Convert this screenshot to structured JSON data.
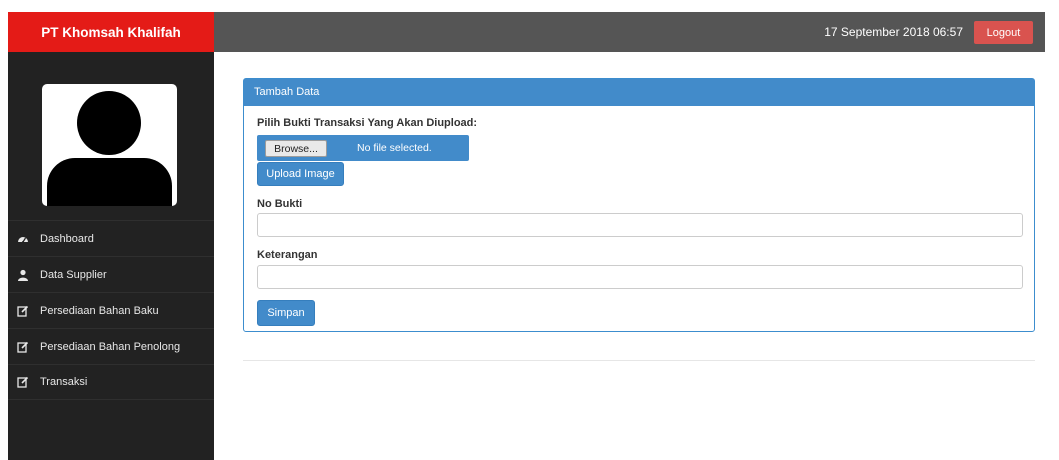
{
  "sidebar": {
    "brand": "PT Khomsah Khalifah",
    "items": [
      {
        "label": "Dashboard",
        "icon": "dashboard-icon"
      },
      {
        "label": "Data Supplier",
        "icon": "user-icon"
      },
      {
        "label": "Persediaan Bahan Baku",
        "icon": "edit-icon"
      },
      {
        "label": "Persediaan Bahan Penolong",
        "icon": "edit-icon"
      },
      {
        "label": "Transaksi",
        "icon": "edit-icon"
      }
    ]
  },
  "header": {
    "datetime": "17 September 2018 06:57",
    "logout_label": "Logout"
  },
  "panel": {
    "title": "Tambah Data",
    "upload_label": "Pilih Bukti Transaksi Yang Akan Diupload:",
    "browse_label": "Browse...",
    "file_status": "No file selected.",
    "upload_button": "Upload Image",
    "no_bukti_label": "No Bukti",
    "no_bukti_value": "",
    "keterangan_label": "Keterangan",
    "keterangan_value": "",
    "save_button": "Simpan"
  },
  "colors": {
    "brand_red": "#e41b17",
    "sidebar_bg": "#222222",
    "topbar_bg": "#555555",
    "primary_blue": "#428bca",
    "logout_red": "#d9534f"
  }
}
